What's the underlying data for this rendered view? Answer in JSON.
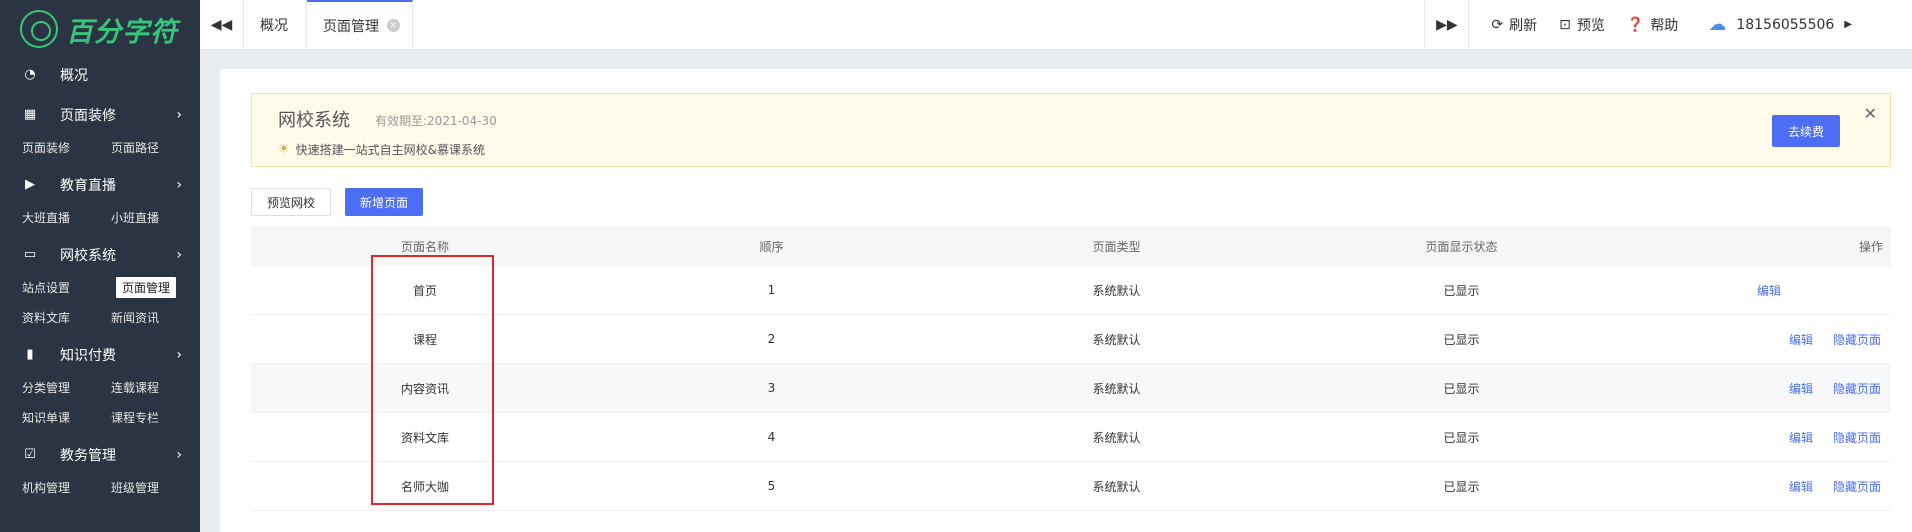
{
  "brand": {
    "name": "百分字符"
  },
  "sidebar": {
    "groups": [
      {
        "label": "概况",
        "icon": "pie-chart-icon",
        "has_arrow": false,
        "items": []
      },
      {
        "label": "页面装修",
        "icon": "brush-icon",
        "has_arrow": true,
        "items": [
          "页面装修",
          "页面路径"
        ]
      },
      {
        "label": "教育直播",
        "icon": "video-icon",
        "has_arrow": true,
        "items": [
          "大班直播",
          "小班直播"
        ]
      },
      {
        "label": "网校系统",
        "icon": "monitor-icon",
        "has_arrow": true,
        "items": [
          "站点设置",
          "页面管理",
          "资料文库",
          "新闻资讯"
        ]
      },
      {
        "label": "知识付费",
        "icon": "book-icon",
        "has_arrow": true,
        "items": [
          "分类管理",
          "连载课程",
          "知识单课",
          "课程专栏"
        ]
      },
      {
        "label": "教务管理",
        "icon": "clipboard-icon",
        "has_arrow": true,
        "items": [
          "机构管理",
          "班级管理"
        ]
      }
    ],
    "active_item": "页面管理"
  },
  "topbar": {
    "tabs": [
      {
        "label": "概况",
        "active": false
      },
      {
        "label": "页面管理",
        "active": true
      }
    ],
    "tools": [
      {
        "label": "刷新",
        "icon": "refresh-icon"
      },
      {
        "label": "预览",
        "icon": "preview-icon"
      },
      {
        "label": "帮助",
        "icon": "help-icon"
      }
    ],
    "user": "18156055506"
  },
  "banner": {
    "title": "网校系统",
    "expiry": "有效期至:2021-04-30",
    "tip": "快速搭建一站式自主网校&慕课系统",
    "renew_label": "去续费"
  },
  "actions": {
    "preview_label": "预览网校",
    "add_label": "新增页面"
  },
  "table": {
    "headers": [
      "页面名称",
      "顺序",
      "页面类型",
      "页面显示状态",
      "操作"
    ],
    "rows": [
      {
        "name": "首页",
        "order": "1",
        "type": "系统默认",
        "status": "已显示",
        "ops": [
          "编辑"
        ]
      },
      {
        "name": "课程",
        "order": "2",
        "type": "系统默认",
        "status": "已显示",
        "ops": [
          "编辑",
          "隐藏页面"
        ]
      },
      {
        "name": "内容资讯",
        "order": "3",
        "type": "系统默认",
        "status": "已显示",
        "ops": [
          "编辑",
          "隐藏页面"
        ]
      },
      {
        "name": "资料文库",
        "order": "4",
        "type": "系统默认",
        "status": "已显示",
        "ops": [
          "编辑",
          "隐藏页面"
        ]
      },
      {
        "name": "名师大咖",
        "order": "5",
        "type": "系统默认",
        "status": "已显示",
        "ops": [
          "编辑",
          "隐藏页面"
        ]
      }
    ]
  },
  "colors": {
    "sidebar_bg": "#2b3442",
    "brand": "#35c67a",
    "accent": "#4c6ef5",
    "highlight": "#e0262a"
  }
}
